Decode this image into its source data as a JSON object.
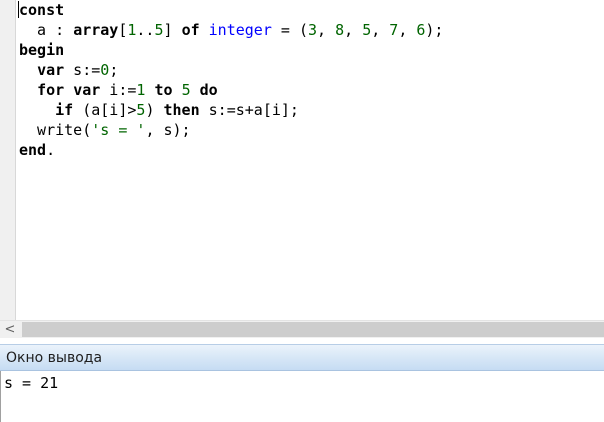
{
  "editor": {
    "lines": [
      [
        {
          "t": "const",
          "c": "kw"
        }
      ],
      [
        {
          "t": "  a : ",
          "c": "txt"
        },
        {
          "t": "array",
          "c": "kw"
        },
        {
          "t": "[",
          "c": "op"
        },
        {
          "t": "1",
          "c": "num"
        },
        {
          "t": "..",
          "c": "op"
        },
        {
          "t": "5",
          "c": "num"
        },
        {
          "t": "] ",
          "c": "op"
        },
        {
          "t": "of",
          "c": "kw"
        },
        {
          "t": " ",
          "c": "txt"
        },
        {
          "t": "integer",
          "c": "typ"
        },
        {
          "t": " = (",
          "c": "op"
        },
        {
          "t": "3",
          "c": "num"
        },
        {
          "t": ", ",
          "c": "op"
        },
        {
          "t": "8",
          "c": "num"
        },
        {
          "t": ", ",
          "c": "op"
        },
        {
          "t": "5",
          "c": "num"
        },
        {
          "t": ", ",
          "c": "op"
        },
        {
          "t": "7",
          "c": "num"
        },
        {
          "t": ", ",
          "c": "op"
        },
        {
          "t": "6",
          "c": "num"
        },
        {
          "t": ");",
          "c": "op"
        }
      ],
      [
        {
          "t": "begin",
          "c": "kw"
        }
      ],
      [
        {
          "t": "  ",
          "c": "txt"
        },
        {
          "t": "var",
          "c": "kw"
        },
        {
          "t": " s:=",
          "c": "txt"
        },
        {
          "t": "0",
          "c": "num"
        },
        {
          "t": ";",
          "c": "op"
        }
      ],
      [
        {
          "t": "  ",
          "c": "txt"
        },
        {
          "t": "for",
          "c": "kw"
        },
        {
          "t": " ",
          "c": "txt"
        },
        {
          "t": "var",
          "c": "kw"
        },
        {
          "t": " i:=",
          "c": "txt"
        },
        {
          "t": "1",
          "c": "num"
        },
        {
          "t": " ",
          "c": "txt"
        },
        {
          "t": "to",
          "c": "kw"
        },
        {
          "t": " ",
          "c": "txt"
        },
        {
          "t": "5",
          "c": "num"
        },
        {
          "t": " ",
          "c": "txt"
        },
        {
          "t": "do",
          "c": "kw"
        }
      ],
      [
        {
          "t": "    ",
          "c": "txt"
        },
        {
          "t": "if",
          "c": "kw"
        },
        {
          "t": " (a[i]>",
          "c": "txt"
        },
        {
          "t": "5",
          "c": "num"
        },
        {
          "t": ") ",
          "c": "txt"
        },
        {
          "t": "then",
          "c": "kw"
        },
        {
          "t": " s:=s+a[i];",
          "c": "txt"
        }
      ],
      [
        {
          "t": "  write(",
          "c": "txt"
        },
        {
          "t": "'s = '",
          "c": "str"
        },
        {
          "t": ", s);",
          "c": "txt"
        }
      ],
      [
        {
          "t": "end",
          "c": "kw"
        },
        {
          "t": ".",
          "c": "op"
        }
      ]
    ]
  },
  "scrollbar": {
    "left_arrow": "<"
  },
  "output": {
    "title": "Окно вывода",
    "text": "s = 21"
  }
}
